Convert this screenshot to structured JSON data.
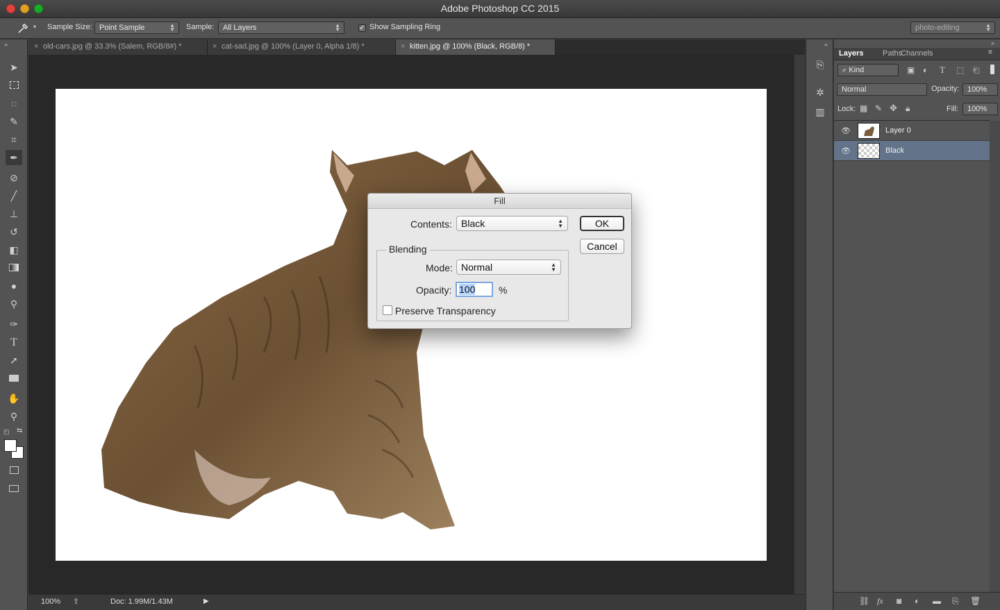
{
  "app": {
    "title": "Adobe Photoshop CC 2015"
  },
  "options_bar": {
    "sample_size_label": "Sample Size:",
    "sample_size_value": "Point Sample",
    "sample_label": "Sample:",
    "sample_value": "All Layers",
    "show_sampling_ring_label": "Show Sampling Ring",
    "show_sampling_ring_checked": true,
    "workspace_value": "photo-editing"
  },
  "doc_tabs": [
    {
      "label": "old-cars.jpg @ 33.3% (Salem, RGB/8#) *",
      "active": false
    },
    {
      "label": "cat-sad.jpg @ 100% (Layer 0, Alpha 1/8) *",
      "active": false
    },
    {
      "label": "kitten.jpg @ 100% (Black, RGB/8) *",
      "active": true
    }
  ],
  "tools": [
    "move-tool-icon",
    "marquee-tool-icon",
    "lasso-tool-icon",
    "quick-selection-tool-icon",
    "crop-tool-icon",
    "eyedropper-tool-icon",
    "healing-brush-tool-icon",
    "brush-tool-icon",
    "clone-stamp-tool-icon",
    "history-brush-tool-icon",
    "eraser-tool-icon",
    "gradient-tool-icon",
    "blur-tool-icon",
    "dodge-tool-icon",
    "pen-tool-icon",
    "type-tool-icon",
    "path-selection-tool-icon",
    "rectangle-tool-icon",
    "hand-tool-icon",
    "zoom-tool-icon"
  ],
  "status_bar": {
    "zoom": "100%",
    "doc_info": "Doc: 1.99M/1.43M"
  },
  "layers_panel": {
    "tabs": [
      "Layers",
      "Paths",
      "Channels"
    ],
    "filter_kind": "Kind",
    "blend_mode": "Normal",
    "opacity_label": "Opacity:",
    "opacity_value": "100%",
    "lock_label": "Lock:",
    "fill_label": "Fill:",
    "fill_value": "100%",
    "layers": [
      {
        "name": "Layer 0",
        "selected": false
      },
      {
        "name": "Black",
        "selected": true
      }
    ]
  },
  "fill_dialog": {
    "title": "Fill",
    "contents_label": "Contents:",
    "contents_value": "Black",
    "ok_label": "OK",
    "cancel_label": "Cancel",
    "blending_label": "Blending",
    "mode_label": "Mode:",
    "mode_value": "Normal",
    "opacity_label": "Opacity:",
    "opacity_value": "100",
    "opacity_unit": "%",
    "preserve_transparency_label": "Preserve Transparency",
    "preserve_transparency_checked": false
  },
  "colors": {
    "foreground": "#ffffff",
    "background": "#ffffff",
    "selected_layer": "#63738a"
  }
}
